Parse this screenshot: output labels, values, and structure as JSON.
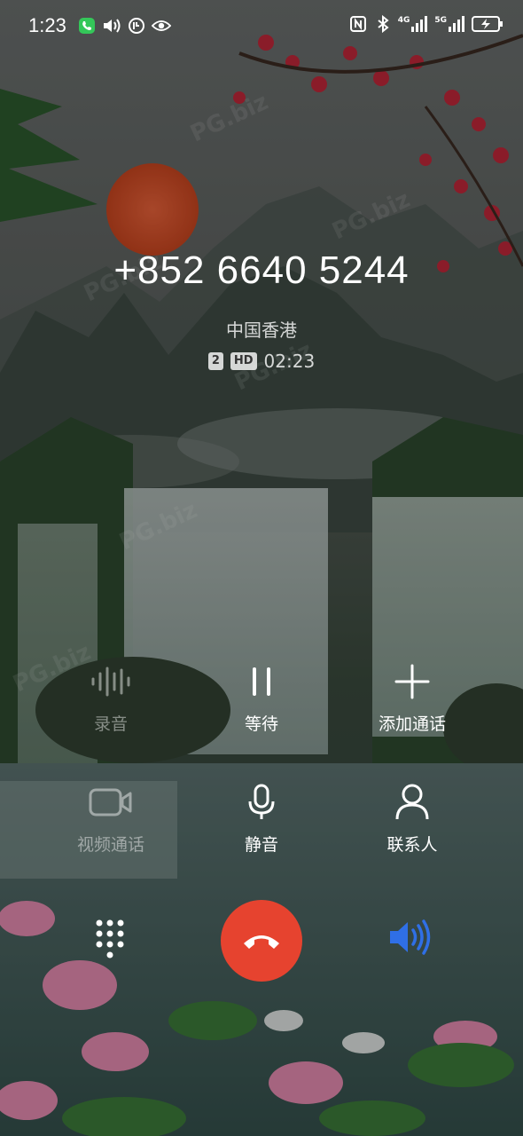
{
  "status_bar": {
    "time": "1:23",
    "network_1": "4G",
    "network_2": "5G",
    "icons": [
      "call-active-icon",
      "volume-icon",
      "data-saver-icon",
      "eye-icon",
      "nfc-icon",
      "bluetooth-icon",
      "signal-icon",
      "battery-charging-icon"
    ]
  },
  "call": {
    "number": "+852 6640 5244",
    "location": "中国香港",
    "sim_badge": "2",
    "hd_badge": "HD",
    "duration": "02:23"
  },
  "controls": {
    "record": "录音",
    "hold": "等待",
    "add_call": "添加通话",
    "video_call": "视频通话",
    "mute": "静音",
    "contacts": "联系人"
  },
  "colors": {
    "hangup": "#e6432f",
    "speaker_active": "#2f6fe6"
  }
}
